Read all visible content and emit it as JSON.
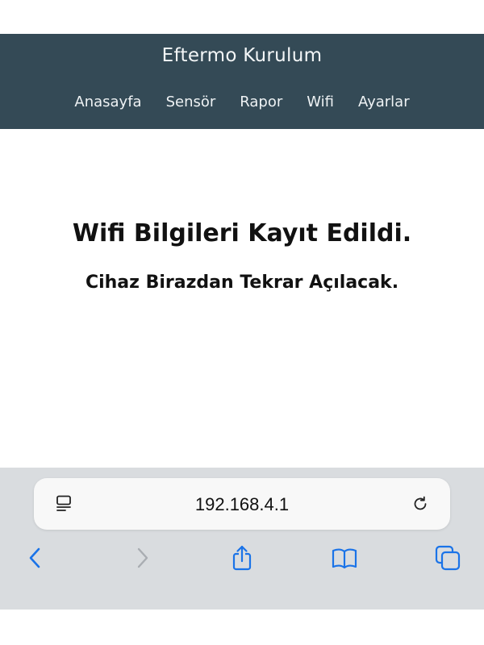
{
  "header": {
    "title": "Eftermo Kurulum",
    "nav": [
      "Anasayfa",
      "Sensör",
      "Rapor",
      "Wifi",
      "Ayarlar"
    ]
  },
  "message": {
    "title": "Wifi Bilgileri Kayıt Edildi.",
    "subtitle": "Cihaz Birazdan Tekrar Açılacak."
  },
  "browser": {
    "url": "192.168.4.1",
    "icons": {
      "page_settings": "reader-format-icon",
      "reload": "reload-icon",
      "back": "chevron-left-icon",
      "forward": "chevron-right-icon",
      "share": "share-icon",
      "bookmarks": "bookmarks-book-icon",
      "tabs": "tabs-icon"
    }
  },
  "colors": {
    "header_bg": "#344a56",
    "browser_bg": "#d9dcdf",
    "accent": "#1a73e8"
  }
}
